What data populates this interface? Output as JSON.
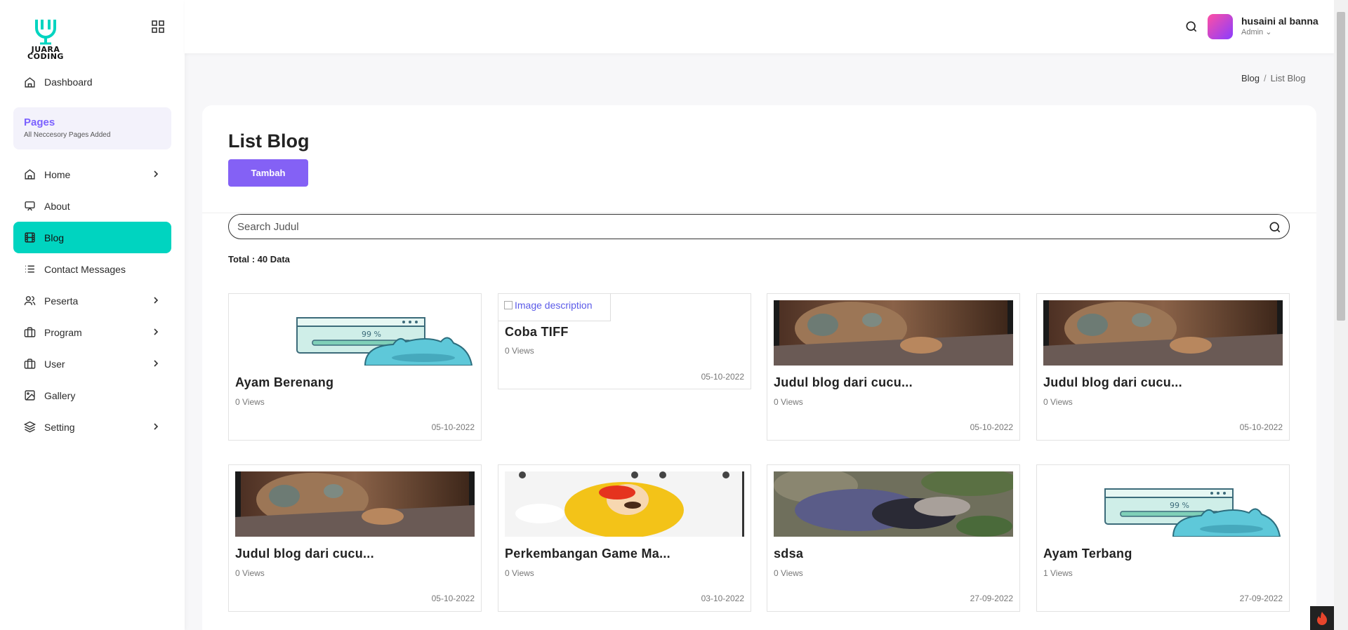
{
  "brand": {
    "logo_text_line1": "JUARA",
    "logo_text_line2": "CODING",
    "accent": "#00d4c0",
    "primary": "#8461f5"
  },
  "sidebar": {
    "dashboard": "Dashboard",
    "pages_title": "Pages",
    "pages_sub": "All Neccesory Pages Added",
    "items": [
      {
        "label": "Home",
        "icon": "home-icon",
        "chevron": true
      },
      {
        "label": "About",
        "icon": "monitor-icon",
        "chevron": false
      },
      {
        "label": "Blog",
        "icon": "film-icon",
        "chevron": false,
        "active": true
      },
      {
        "label": "Contact Messages",
        "icon": "list-icon",
        "chevron": false
      },
      {
        "label": "Peserta",
        "icon": "users-icon",
        "chevron": true
      },
      {
        "label": "Program",
        "icon": "briefcase-icon",
        "chevron": true
      },
      {
        "label": "User",
        "icon": "briefcase-icon",
        "chevron": true
      },
      {
        "label": "Gallery",
        "icon": "image-icon",
        "chevron": false
      },
      {
        "label": "Setting",
        "icon": "layers-icon",
        "chevron": true
      }
    ]
  },
  "header": {
    "user_name": "husaini al banna",
    "user_role": "Admin"
  },
  "breadcrumb": {
    "parent": "Blog",
    "sep": "/",
    "current": "List Blog"
  },
  "main": {
    "title": "List Blog",
    "add_button": "Tambah",
    "search_placeholder": "Search Judul",
    "total": "Total : 40 Data"
  },
  "cards": [
    {
      "title": "Ayam Berenang",
      "views": "0 Views",
      "date": "05-10-2022",
      "thumb": "progress-illustration"
    },
    {
      "title": "Coba TIFF",
      "views": "0 Views",
      "date": "05-10-2022",
      "thumb": "broken",
      "alt": "Image description"
    },
    {
      "title": "Judul blog dari cucu...",
      "views": "0 Views",
      "date": "05-10-2022",
      "thumb": "cat-laptop"
    },
    {
      "title": "Judul blog dari cucu...",
      "views": "0 Views",
      "date": "05-10-2022",
      "thumb": "cat-laptop"
    },
    {
      "title": "Judul blog dari cucu...",
      "views": "0 Views",
      "date": "05-10-2022",
      "thumb": "cat-laptop"
    },
    {
      "title": "Perkembangan Game Ma...",
      "views": "0 Views",
      "date": "03-10-2022",
      "thumb": "mario-cat"
    },
    {
      "title": "sdsa",
      "views": "0 Views",
      "date": "27-09-2022",
      "thumb": "dogs-ground"
    },
    {
      "title": "Ayam Terbang",
      "views": "1 Views",
      "date": "27-09-2022",
      "thumb": "progress-illustration"
    }
  ]
}
